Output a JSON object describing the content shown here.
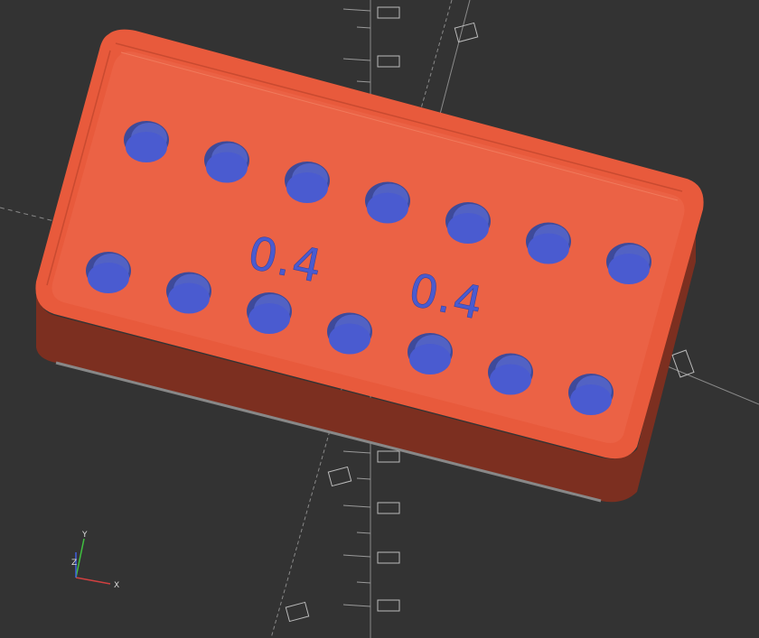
{
  "viewport": {
    "background_color": "#333333",
    "model": {
      "body_color": "#eb6245",
      "rim_color": "#e85a3c",
      "side_color": "#7c2f20",
      "hole_color": "#4a5bd0",
      "hole_rows": [
        7,
        7
      ],
      "labels": [
        "0.4",
        "0.4"
      ]
    },
    "axis_indicator": {
      "x_label": "X",
      "y_label": "Y",
      "z_label": "Z",
      "x_color": "#d04040",
      "y_color": "#40c040",
      "z_color": "#4060e0"
    }
  }
}
